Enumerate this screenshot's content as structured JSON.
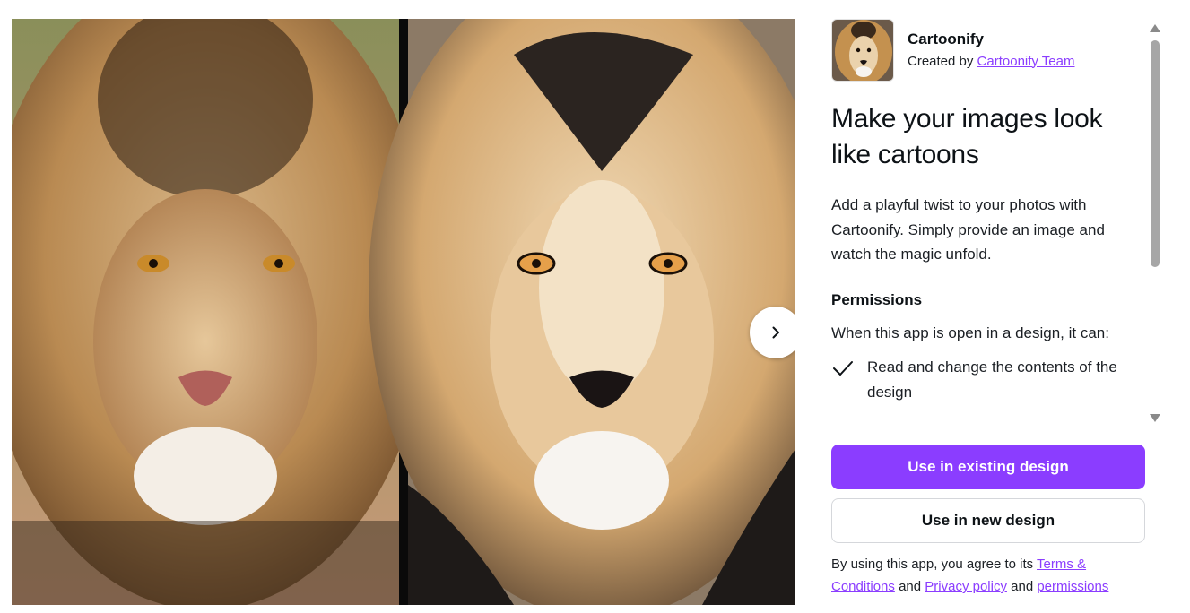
{
  "preview": {
    "next_icon": "chevron-right-icon"
  },
  "app": {
    "name": "Cartoonify",
    "created_by_prefix": "Created by",
    "creator": "Cartoonify Team",
    "icon": "lion-cartoon-thumbnail"
  },
  "headline": "Make your images look like cartoons",
  "description": "Add a playful twist to your photos with Cartoonify. Simply provide an image and watch the magic unfold.",
  "permissions": {
    "title": "Permissions",
    "intro": "When this app is open in a design, it can:",
    "items": [
      {
        "icon": "check-icon",
        "text": "Read and change the contents of the design"
      }
    ]
  },
  "buttons": {
    "primary": "Use in existing design",
    "secondary": "Use in new design"
  },
  "legal": {
    "prefix": "By using this app, you agree to its",
    "terms": "Terms & Conditions",
    "and1": "and",
    "privacy": "Privacy policy",
    "and2": "and",
    "permissions": "permissions"
  },
  "colors": {
    "accent": "#8b3dff",
    "text": "#0d1216"
  }
}
